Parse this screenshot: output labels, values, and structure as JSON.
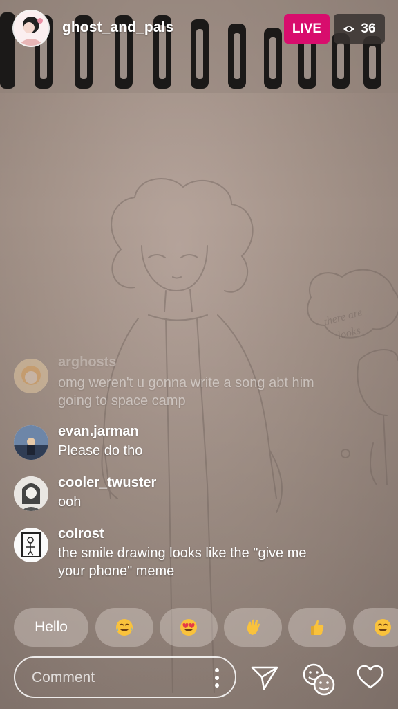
{
  "header": {
    "host_username": "ghost_and_pals",
    "live_label": "LIVE",
    "viewer_count": "36"
  },
  "comments": [
    {
      "username": "arghosts",
      "text": "omg weren't u gonna write a song abt him going to space camp"
    },
    {
      "username": "evan.jarman",
      "text": "Please do tho"
    },
    {
      "username": "cooler_twuster",
      "text": "ooh"
    },
    {
      "username": "colrost",
      "text": "the smile drawing looks like the \"give me your phone\" meme"
    }
  ],
  "quick_replies": {
    "hello_label": "Hello",
    "emojis": [
      "face-with-tears-of-joy",
      "smiling-face-with-heart-eyes",
      "waving-hand",
      "thumbs-up",
      "face-with-tears-of-joy"
    ]
  },
  "composer": {
    "placeholder": "Comment"
  },
  "colors": {
    "live_badge": "#d80d6d",
    "viewer_badge": "#373230",
    "paper": "#a49389"
  }
}
